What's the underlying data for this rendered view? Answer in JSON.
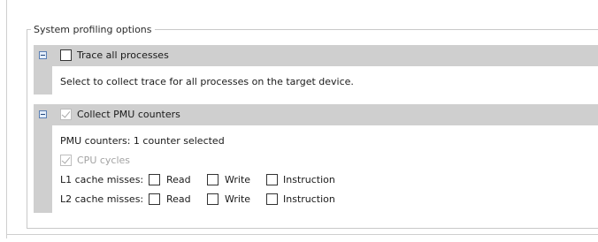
{
  "group_title": "System profiling options",
  "trace_section": {
    "checkbox_label": "Trace all processes",
    "checked": false,
    "description": "Select to collect trace for all processes on the target device."
  },
  "pmu_section": {
    "checkbox_label": "Collect PMU counters",
    "checked": true,
    "status_text": "PMU counters: 1 counter selected",
    "cpu_cycles_label": "CPU cycles",
    "cpu_cycles_checked": true,
    "l1_label": "L1 cache misses:",
    "l2_label": "L2 cache misses:",
    "options": [
      "Read",
      "Write",
      "Instruction"
    ]
  }
}
